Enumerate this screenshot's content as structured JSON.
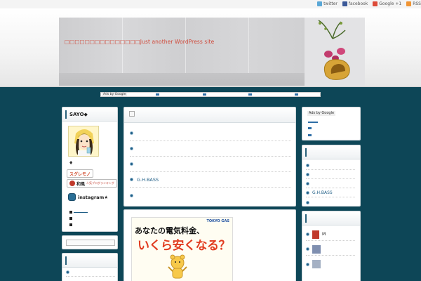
{
  "topnav": [
    {
      "label": "twitter",
      "icon": "twitter-icon"
    },
    {
      "label": "facebook",
      "icon": "facebook-icon"
    },
    {
      "label": "Google +1",
      "icon": "google-plus-icon"
    },
    {
      "label": "RSS",
      "icon": "rss-icon"
    }
  ],
  "header": {
    "site_title": "□□□□□□□□□□□□□□□Just another WordPress site"
  },
  "ads": {
    "label": "Ads by Google"
  },
  "left_sidebar": {
    "profile": {
      "title": "SAYO◆",
      "line": "♦",
      "badge_1": "スグレモノ",
      "badge_2": "和風",
      "badge_2_sub": "人気ブログランキング",
      "instagram": "instagram★"
    }
  },
  "main": {
    "list": [
      "",
      "",
      "",
      "G.H.BASS",
      ""
    ],
    "ad": {
      "brand": "TOKYO GAS",
      "line1": "あなたの電気料金、",
      "line2": "いくら安くなる？"
    }
  },
  "right_sidebar": {
    "ads_label": "Ads by Google",
    "list": [
      "",
      "",
      "",
      "G.H.BASS",
      ""
    ],
    "recent": [
      {
        "label": "M"
      },
      {
        "label": ""
      },
      {
        "label": ""
      }
    ]
  },
  "colors": {
    "background": "#0d4657",
    "accent": "#1f5e86",
    "title": "#d0493a",
    "gas_red": "#e13c20"
  }
}
